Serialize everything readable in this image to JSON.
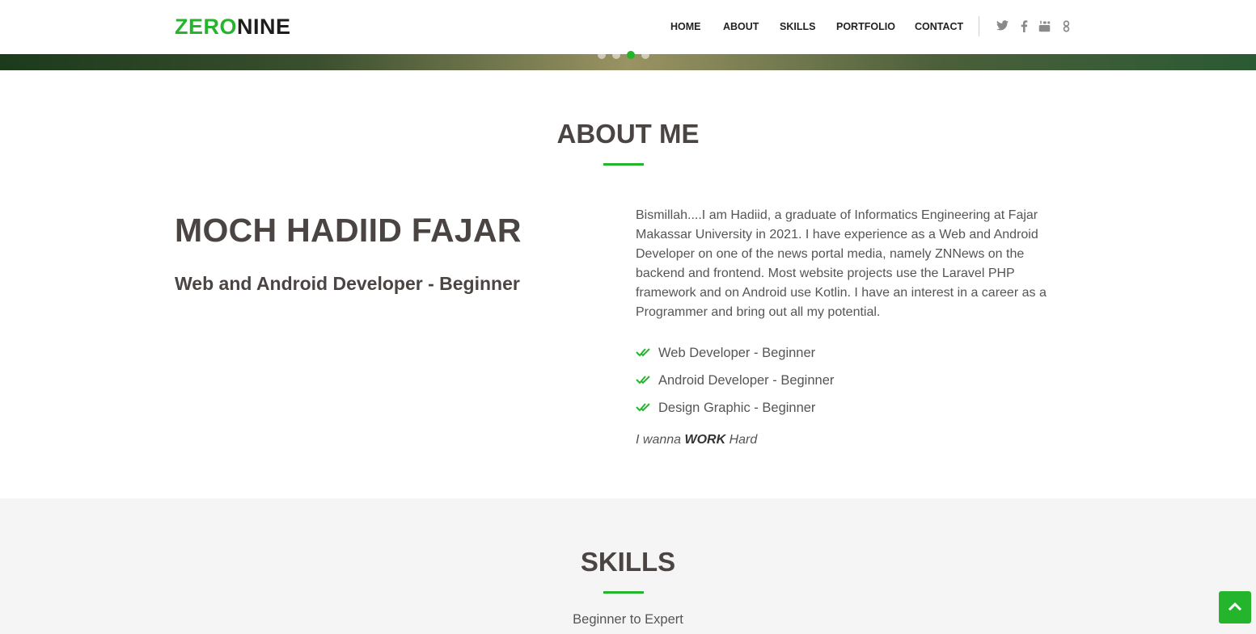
{
  "header": {
    "logo_green": "ZERO",
    "logo_dark": "NINE",
    "nav": [
      {
        "label": "HOME"
      },
      {
        "label": "ABOUT"
      },
      {
        "label": "SKILLS"
      },
      {
        "label": "PORTFOLIO"
      },
      {
        "label": "CONTACT"
      }
    ],
    "social_icons": [
      "twitter-icon",
      "facebook-icon",
      "youtube-icon",
      "google-icon"
    ]
  },
  "hero": {
    "slider_dots": 4,
    "active_dot": 3
  },
  "about": {
    "title": "ABOUT ME",
    "name": "MOCH HADIID FAJAR",
    "role": "Web and Android Developer - Beginner",
    "bio": "Bismillah....I am Hadiid, a graduate of Informatics Engineering at Fajar Makassar University in 2021. I have experience as a Web and Android Developer on one of the news portal media, namely ZNNews on the backend and frontend. Most website projects use the Laravel PHP framework and on Android use Kotlin. I have an interest in a career as a Programmer and bring out all my potential.",
    "skills_list": [
      {
        "label": "Web Developer - Beginner"
      },
      {
        "label": "Android Developer - Beginner"
      },
      {
        "label": "Design Graphic - Beginner"
      }
    ],
    "quote_pre": "I wanna ",
    "quote_bold": "WORK",
    "quote_post": " Hard"
  },
  "skills": {
    "title": "SKILLS",
    "subtitle": "Beginner to Expert"
  },
  "colors": {
    "accent": "#25b52c",
    "heading": "#4a4443",
    "section_bg": "#f5f5f5"
  }
}
